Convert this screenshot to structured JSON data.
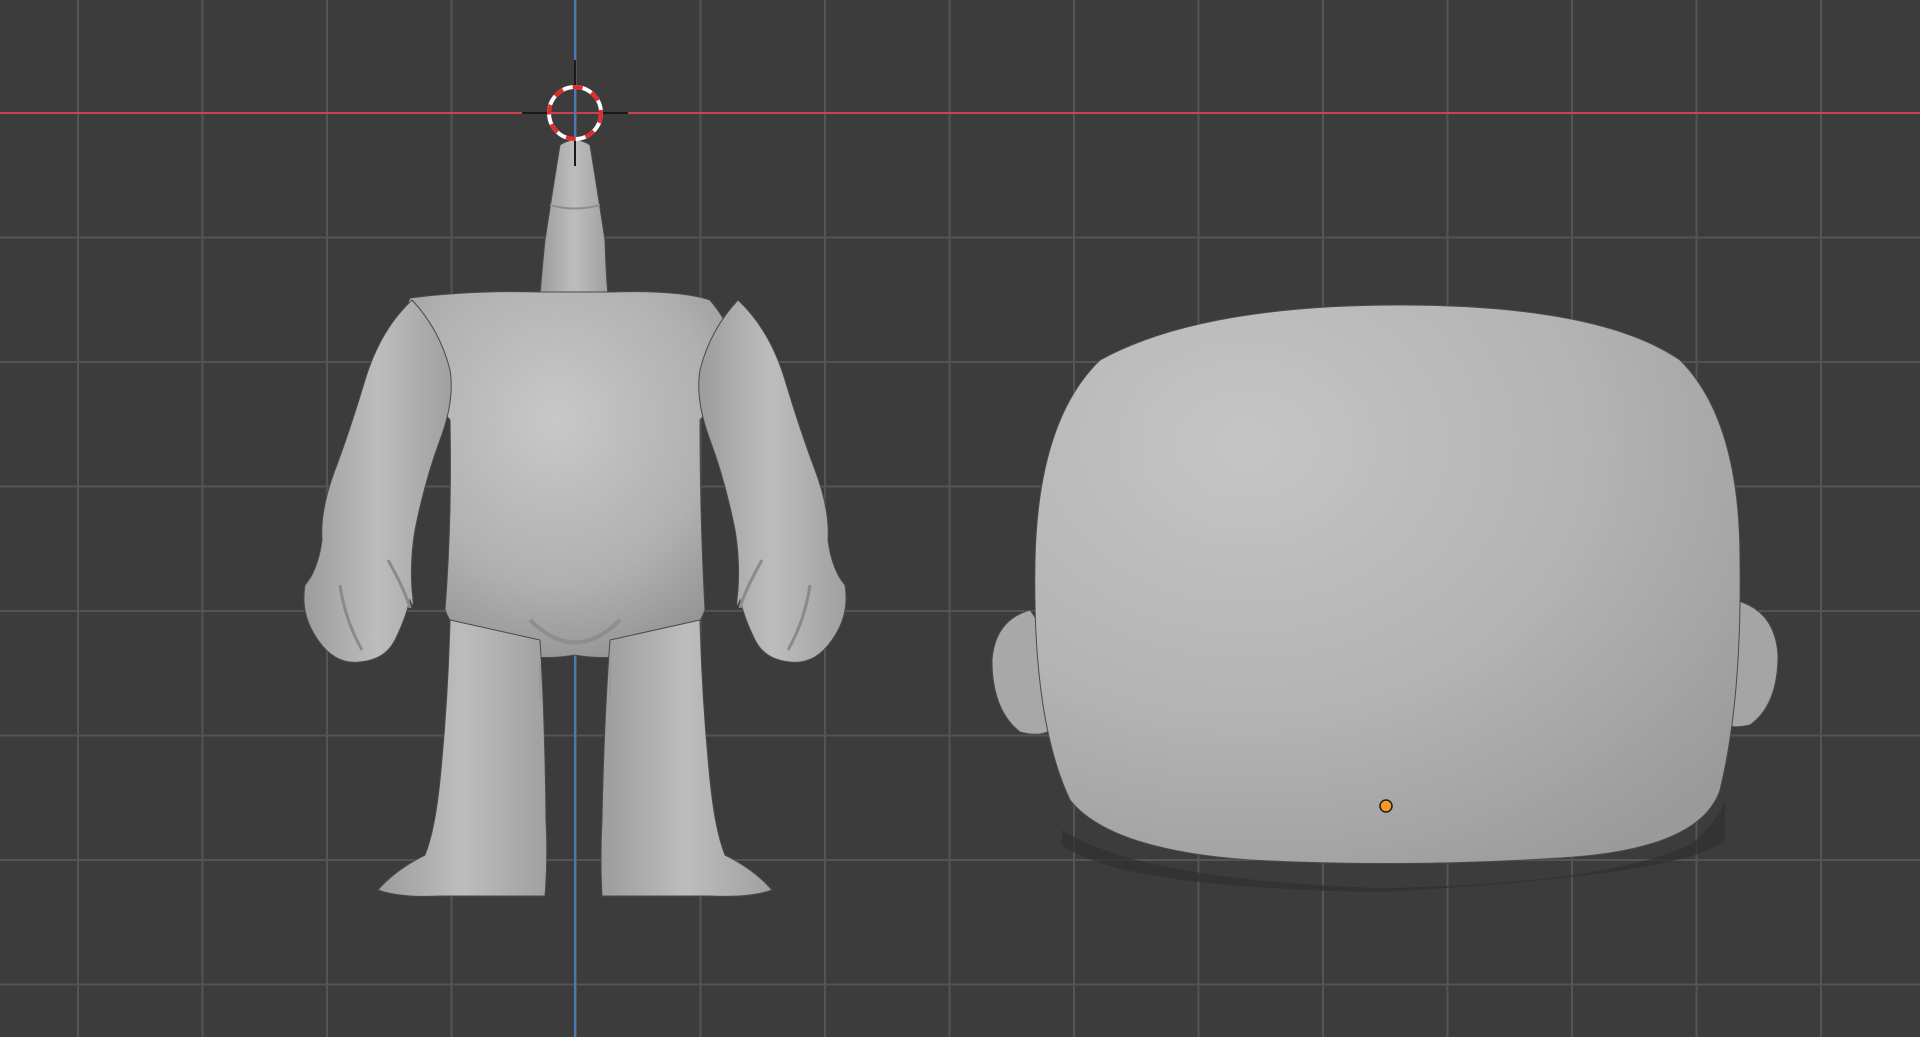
{
  "viewport": {
    "background_color": "#3c3c3c",
    "grid_color": "#545454",
    "x_axis_color": "#c7444e",
    "z_axis_color": "#4a79b8",
    "cursor_colors": [
      "#e52a2a",
      "#ffffff"
    ],
    "origin_color": "#f59a23",
    "mesh_color": "#b4b4b4"
  },
  "objects": [
    {
      "name": "Body",
      "type": "mesh"
    },
    {
      "name": "Head",
      "type": "mesh"
    }
  ],
  "icons": {
    "cursor": "3d-cursor-icon",
    "origin": "object-origin-icon"
  }
}
